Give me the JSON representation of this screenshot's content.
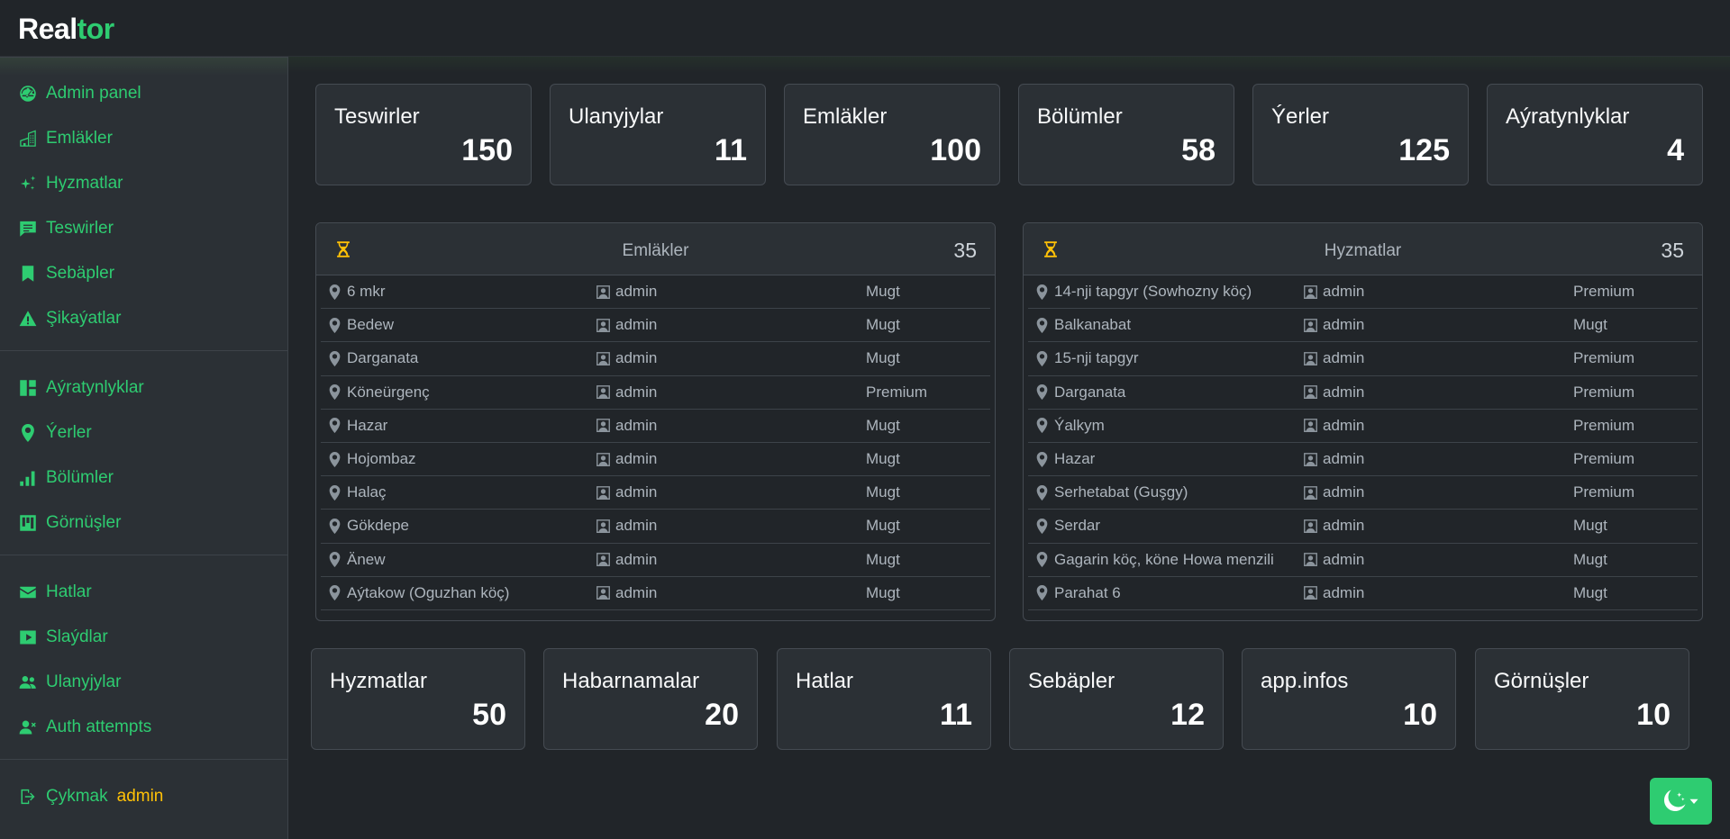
{
  "brand": {
    "part1": "Real",
    "part2": "tor"
  },
  "sidebar": {
    "group1": [
      {
        "label": "Admin panel",
        "icon": "dashboard-icon"
      },
      {
        "label": "Emläkler",
        "icon": "buildings-icon"
      },
      {
        "label": "Hyzmatlar",
        "icon": "sparkles-icon"
      },
      {
        "label": "Teswirler",
        "icon": "chat-icon"
      },
      {
        "label": "Sebäpler",
        "icon": "bookmark-icon"
      },
      {
        "label": "Şikaýatlar",
        "icon": "warning-icon"
      }
    ],
    "group2": [
      {
        "label": "Aýratynlyklar",
        "icon": "layout-icon"
      },
      {
        "label": "Ýerler",
        "icon": "location-pin-icon"
      },
      {
        "label": "Bölümler",
        "icon": "bar-chart-icon"
      },
      {
        "label": "Görnüşler",
        "icon": "kanban-icon"
      }
    ],
    "group3": [
      {
        "label": "Hatlar",
        "icon": "envelope-icon"
      },
      {
        "label": "Slaýdlar",
        "icon": "play-icon"
      },
      {
        "label": "Ulanyjylar",
        "icon": "users-icon"
      },
      {
        "label": "Auth attempts",
        "icon": "user-x-icon"
      }
    ],
    "logout": {
      "label": "Çykmak",
      "user": "admin",
      "icon": "logout-icon"
    }
  },
  "top_cards": [
    {
      "title": "Teswirler",
      "value": "150"
    },
    {
      "title": "Ulanyjylar",
      "value": "11"
    },
    {
      "title": "Emläkler",
      "value": "100"
    },
    {
      "title": "Bölümler",
      "value": "58"
    },
    {
      "title": "Ýerler",
      "value": "125"
    },
    {
      "title": "Aýratynlyklar",
      "value": "4"
    }
  ],
  "bottom_cards": [
    {
      "title": "Hyzmatlar",
      "value": "50"
    },
    {
      "title": "Habarnamalar",
      "value": "20"
    },
    {
      "title": "Hatlar",
      "value": "11"
    },
    {
      "title": "Sebäpler",
      "value": "12"
    },
    {
      "title": "app.infos",
      "value": "10"
    },
    {
      "title": "Görnüşler",
      "value": "10"
    }
  ],
  "panels": [
    {
      "title": "Emläkler",
      "count": "35",
      "rows": [
        {
          "location": "6 mkr",
          "user": "admin",
          "type": "Mugt"
        },
        {
          "location": "Bedew",
          "user": "admin",
          "type": "Mugt"
        },
        {
          "location": "Darganata",
          "user": "admin",
          "type": "Mugt"
        },
        {
          "location": "Köneürgenç",
          "user": "admin",
          "type": "Premium"
        },
        {
          "location": "Hazar",
          "user": "admin",
          "type": "Mugt"
        },
        {
          "location": "Hojombaz",
          "user": "admin",
          "type": "Mugt"
        },
        {
          "location": "Halaç",
          "user": "admin",
          "type": "Mugt"
        },
        {
          "location": "Gökdepe",
          "user": "admin",
          "type": "Mugt"
        },
        {
          "location": "Änew",
          "user": "admin",
          "type": "Mugt"
        },
        {
          "location": "Aýtakow (Oguzhan köç)",
          "user": "admin",
          "type": "Mugt"
        }
      ]
    },
    {
      "title": "Hyzmatlar",
      "count": "35",
      "rows": [
        {
          "location": "14-nji tapgyr (Sowhozny köç)",
          "user": "admin",
          "type": "Premium"
        },
        {
          "location": "Balkanabat",
          "user": "admin",
          "type": "Mugt"
        },
        {
          "location": "15-nji tapgyr",
          "user": "admin",
          "type": "Premium"
        },
        {
          "location": "Darganata",
          "user": "admin",
          "type": "Premium"
        },
        {
          "location": "Ýalkym",
          "user": "admin",
          "type": "Premium"
        },
        {
          "location": "Hazar",
          "user": "admin",
          "type": "Premium"
        },
        {
          "location": "Serhetabat (Guşgy)",
          "user": "admin",
          "type": "Premium"
        },
        {
          "location": "Serdar",
          "user": "admin",
          "type": "Mugt"
        },
        {
          "location": "Gagarin köç, köne Howa menzili",
          "user": "admin",
          "type": "Mugt"
        },
        {
          "location": "Parahat 6",
          "user": "admin",
          "type": "Mugt"
        }
      ]
    }
  ],
  "colors": {
    "accent": "#2ecc71",
    "warning": "#ffc107",
    "background": "#212529",
    "surface": "#2b3035"
  }
}
